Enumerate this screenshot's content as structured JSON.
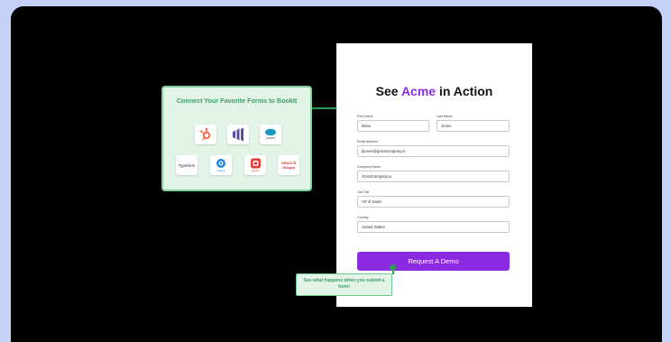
{
  "colors": {
    "page_background": "#c5d1f7",
    "stage_background": "#000000",
    "accent_purple": "#8a2be2",
    "accent_green": "#2e9b57",
    "card_green_bg": "#e2f4e7"
  },
  "connect_card": {
    "title": "Connect Your Favorite Forms to BookIt",
    "integrations": [
      {
        "icon": "hubspot-icon"
      },
      {
        "icon": "marketo-icon"
      },
      {
        "icon": "salesforce-pardot-icon",
        "label": "pardot"
      },
      {
        "icon": "typeform-icon",
        "label": "Typeform"
      },
      {
        "icon": "eloqua-icon",
        "label": "eloqua"
      },
      {
        "icon": "gravity-forms-icon",
        "label": "gravity"
      },
      {
        "icon": "oracle-eloqua-icon",
        "label": "ORACLE Eloqua"
      }
    ]
  },
  "form": {
    "title_prefix": "See ",
    "title_brand": "Acme",
    "title_suffix": " in Action",
    "fields": {
      "first_name": {
        "label": "First Name",
        "value": "Brian"
      },
      "last_name": {
        "label": "Last Name",
        "value": "Jones"
      },
      "email": {
        "label": "Email Address",
        "value": "bjones@greatcompany.io"
      },
      "company": {
        "label": "Company Name",
        "value": "GreatCompany.io"
      },
      "job_title": {
        "label": "Job Title",
        "value": "VP of Sales"
      },
      "country": {
        "label": "Country",
        "value": "United States"
      }
    },
    "submit_label": "Request A Demo"
  },
  "tooltip": {
    "text": "See what happens when you submit a form!"
  }
}
